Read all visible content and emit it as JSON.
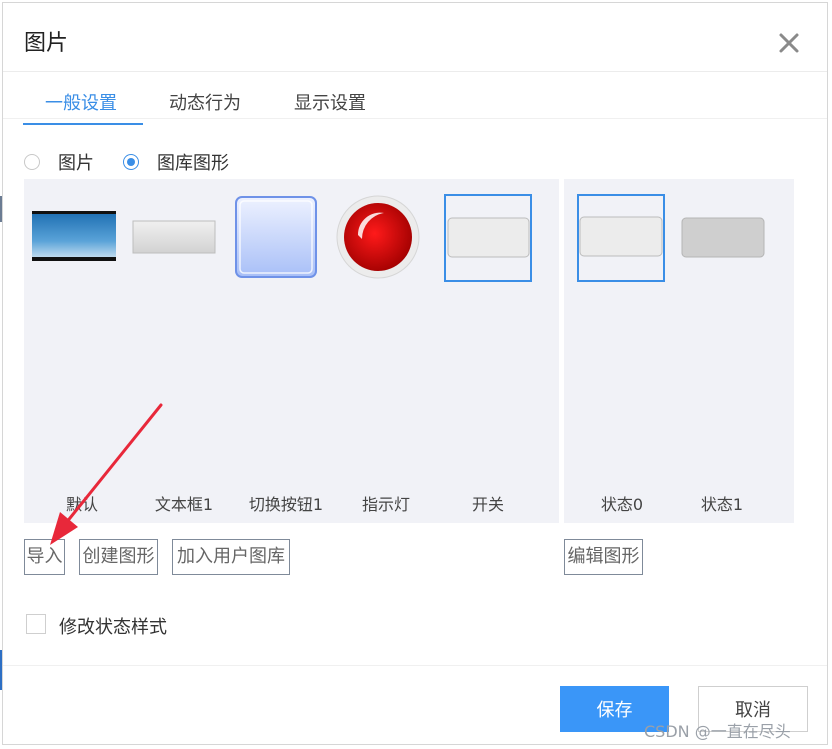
{
  "dialog": {
    "title": "图片",
    "close_icon": "close-icon"
  },
  "tabs": [
    {
      "label": "一般设置",
      "active": true
    },
    {
      "label": "动态行为",
      "active": false
    },
    {
      "label": "显示设置",
      "active": false
    }
  ],
  "source_options": [
    {
      "label": "图片",
      "checked": false
    },
    {
      "label": "图库图形",
      "checked": true
    }
  ],
  "shapes": [
    {
      "label": "默认",
      "icon": "default-image-icon"
    },
    {
      "label": "文本框1",
      "icon": "textbox-icon"
    },
    {
      "label": "切换按钮1",
      "icon": "toggle-button-icon"
    },
    {
      "label": "指示灯",
      "icon": "indicator-light-icon"
    },
    {
      "label": "开关",
      "icon": "switch-icon",
      "selected": true
    }
  ],
  "states": [
    {
      "label": "状态0",
      "icon": "state-0-icon",
      "selected": true
    },
    {
      "label": "状态1",
      "icon": "state-1-icon"
    }
  ],
  "actions": {
    "import": "导入",
    "create_shape": "创建图形",
    "add_to_user_library": "加入用户图库",
    "edit_shape": "编辑图形"
  },
  "modify_state_style": {
    "label": "修改状态样式",
    "checked": false
  },
  "footer": {
    "save": "保存",
    "cancel": "取消"
  },
  "watermark": "CSDN @一直在尽头",
  "colors": {
    "accent": "#3a8ee6",
    "primary_button": "#3a96f8",
    "panel_bg": "#f1f2f7",
    "indicator_red": "#d40000",
    "annotation_arrow": "#e8283a"
  }
}
